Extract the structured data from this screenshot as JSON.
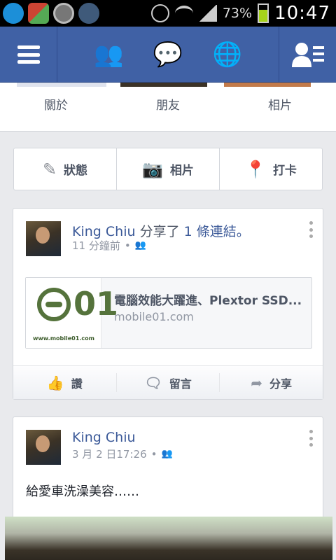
{
  "status_bar": {
    "battery_pct": "73%",
    "time": "10:47",
    "colors": {
      "battery_fill": "#a6d31a"
    }
  },
  "navbar": {
    "bg_color": "#4061a5",
    "icons": [
      "menu-icon",
      "friends-icon",
      "messages-icon",
      "globe-icon",
      "contacts-icon"
    ]
  },
  "profile_tabs": [
    "關於",
    "朋友",
    "相片"
  ],
  "composer": {
    "status": "狀態",
    "photo": "相片",
    "checkin": "打卡"
  },
  "stories": [
    {
      "author": "King Chiu",
      "verb": "分享了",
      "object": "1 條連結。",
      "time": "11 分鐘前",
      "link": {
        "title": "電腦效能大躍進、Plextor SSD...",
        "domain": "mobile01.com",
        "logo_url": "www.mobile01.com"
      },
      "actions": {
        "like": "讚",
        "comment": "留言",
        "share": "分享"
      }
    },
    {
      "author": "King Chiu",
      "time": "3 月 2 日17:26",
      "text": "給愛車洗澡美容……"
    }
  ]
}
